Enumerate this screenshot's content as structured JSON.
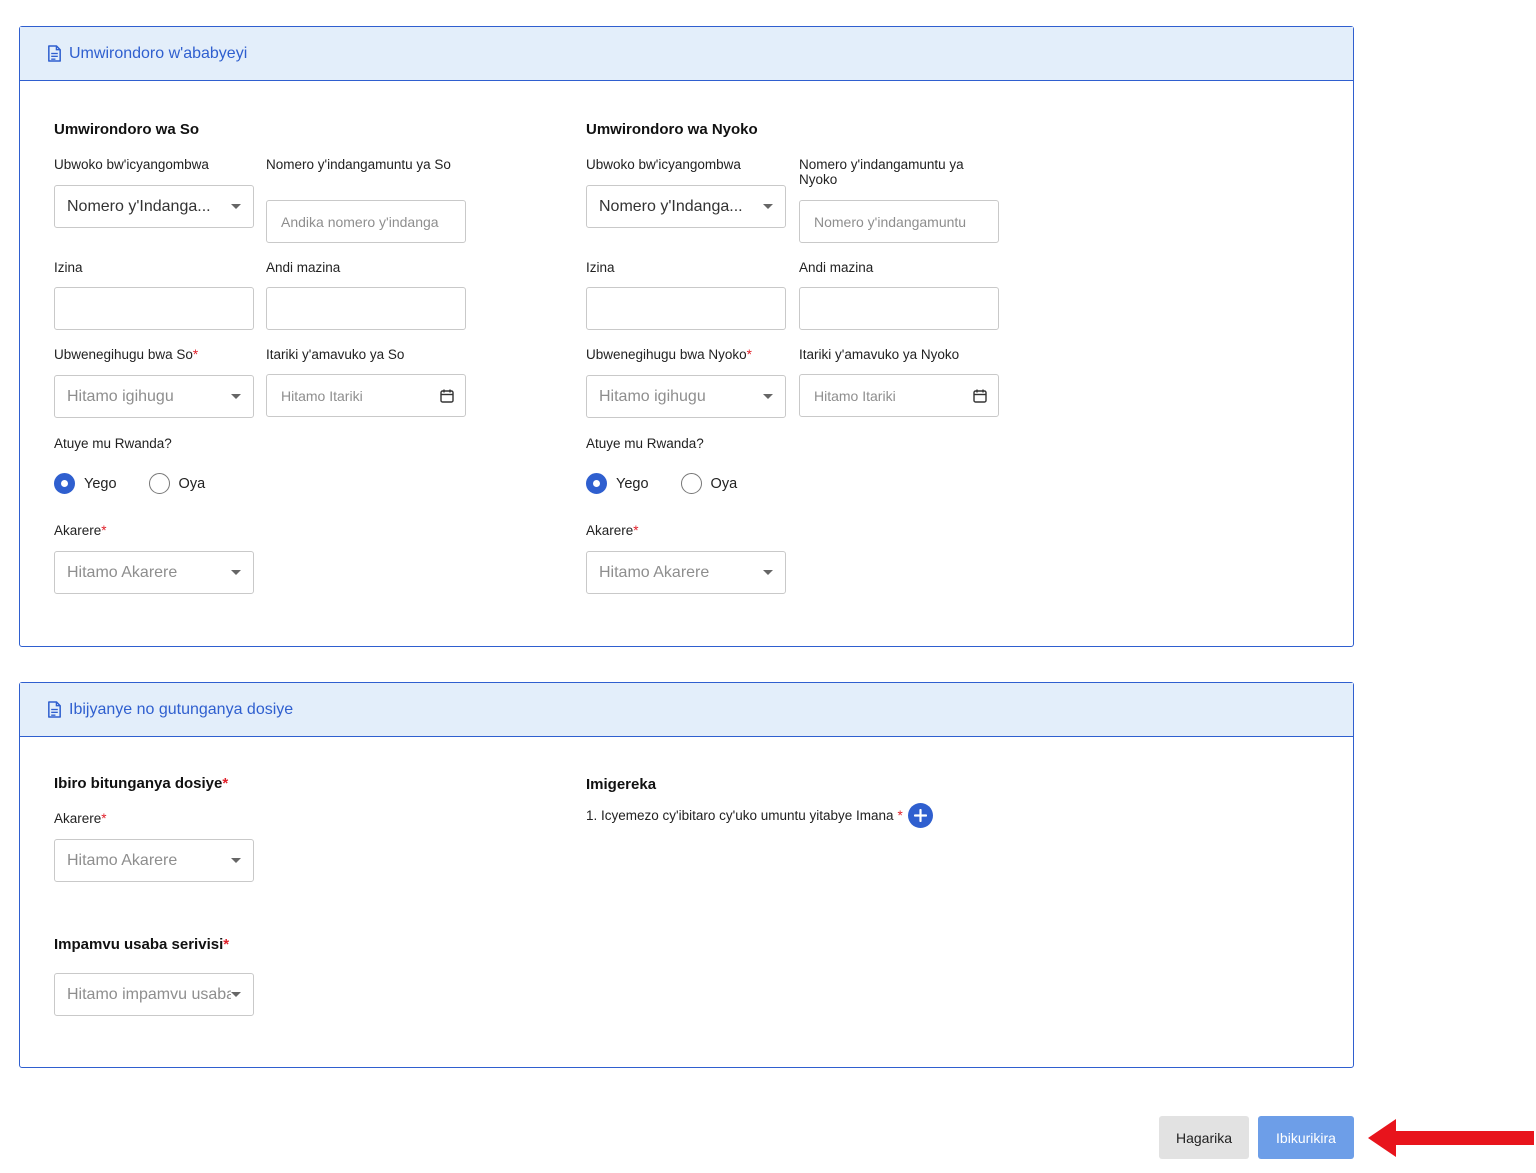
{
  "parents_section": {
    "header": "Umwirondoro w'ababyeyi",
    "father": {
      "title": "Umwirondoro wa So",
      "doc_type_label": "Ubwoko bw'icyangombwa",
      "doc_type_value": "Nomero y'Indanga...",
      "id_label": "Nomero y'indangamuntu ya So",
      "id_placeholder": "Andika nomero y'indanga",
      "first_name_label": "Izina",
      "last_name_label": "Andi mazina",
      "nationality_label": "Ubwenegihugu bwa So",
      "nationality_placeholder": "Hitamo igihugu",
      "dob_label": "Itariki y'amavuko ya So",
      "dob_placeholder": "Hitamo Itariki",
      "lives_label": "Atuye mu Rwanda?",
      "yes": "Yego",
      "no": "Oya",
      "selected": "Yego",
      "district_label": "Akarere",
      "district_placeholder": "Hitamo Akarere"
    },
    "mother": {
      "title": "Umwirondoro wa Nyoko",
      "doc_type_label": "Ubwoko bw'icyangombwa",
      "doc_type_value": "Nomero y'Indanga...",
      "id_label": "Nomero y'indangamuntu ya Nyoko",
      "id_placeholder": "Nomero y'indangamuntu",
      "first_name_label": "Izina",
      "last_name_label": "Andi mazina",
      "nationality_label": "Ubwenegihugu bwa Nyoko",
      "nationality_placeholder": "Hitamo igihugu",
      "dob_label": "Itariki y'amavuko ya Nyoko",
      "dob_placeholder": "Hitamo Itariki",
      "lives_label": "Atuye mu Rwanda?",
      "yes": "Yego",
      "no": "Oya",
      "selected": "Yego",
      "district_label": "Akarere",
      "district_placeholder": "Hitamo Akarere"
    }
  },
  "attachments_section": {
    "header": "Ibijyanye no gutunganya dosiye",
    "office_title": "Ibiro bitunganya dosiye",
    "district_label": "Akarere",
    "district_placeholder": "Hitamo Akarere",
    "reason_title": "Impamvu usaba serivisi",
    "reason_placeholder": "Hitamo impamvu usaba",
    "attachments_title": "Imigereka",
    "attachment_1": "1. Icyemezo cy'ibitaro cy'uko umuntu yitabye Imana",
    "required_mark": "*"
  },
  "actions": {
    "cancel": "Hagarika",
    "submit": "Ibikurikira"
  },
  "colors": {
    "accent": "#2f5fcf",
    "header_bg": "#e3eefa",
    "submit_bg": "#6d9ee8",
    "required": "#e0202a",
    "arrow": "#e8141c"
  }
}
